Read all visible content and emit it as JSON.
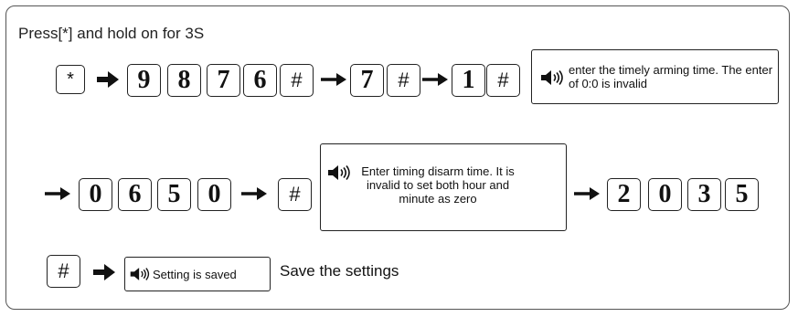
{
  "heading": "Press[*] and hold on for 3S",
  "row1": {
    "key_star": "*",
    "code_keys": [
      "9",
      "8",
      "7",
      "6",
      "#"
    ],
    "menu_keys": [
      "7",
      "#"
    ],
    "option_keys": [
      "1",
      "#"
    ],
    "prompt": "enter the timely arming time. The enter of 0:0 is invalid"
  },
  "row2": {
    "arm_time_keys": [
      "0",
      "6",
      "5",
      "0"
    ],
    "confirm_key": "#",
    "prompt": "Enter timing disarm time.  It is invalid to set both hour and minute as zero",
    "disarm_time_keys": [
      "2",
      "0",
      "3",
      "5"
    ]
  },
  "row3": {
    "confirm_key": "#",
    "prompt": "Setting is saved",
    "note": "Save  the settings"
  },
  "icons": [
    "arrow-right-icon",
    "speaker-icon"
  ],
  "colors": {
    "ink": "#111111",
    "frame": "#555555"
  }
}
